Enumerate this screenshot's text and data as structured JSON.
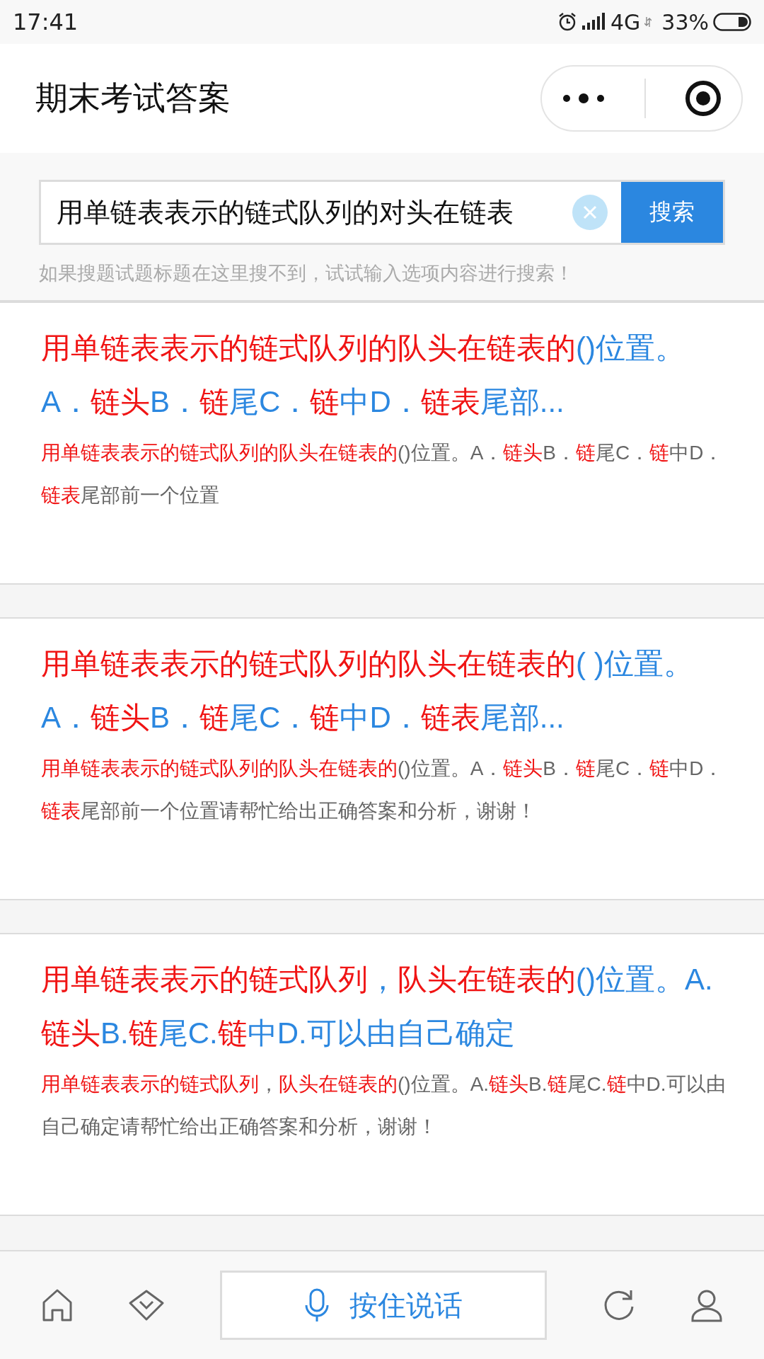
{
  "status_bar": {
    "time": "17:41",
    "network": "4G",
    "battery": "33%"
  },
  "header": {
    "title": "期末考试答案"
  },
  "search": {
    "value": "用单链表表示的链式队列的对头在链表",
    "button": "搜索",
    "hint": "如果搜题试题标题在这里搜不到，试试输入选项内容进行搜索！"
  },
  "results": [
    {
      "title": [
        {
          "text": "用单链表表示的链式队列的队头在链表的",
          "hl": true
        },
        {
          "text": "()位置。A．",
          "hl": false
        },
        {
          "text": "链头",
          "hl": true
        },
        {
          "text": "B．",
          "hl": false
        },
        {
          "text": "链",
          "hl": true
        },
        {
          "text": "尾C．",
          "hl": false
        },
        {
          "text": "链",
          "hl": true
        },
        {
          "text": "中D．",
          "hl": false
        },
        {
          "text": "链表",
          "hl": true
        },
        {
          "text": "尾部...",
          "hl": false
        }
      ],
      "snippet": [
        {
          "text": "用单链表表示的链式队列的队头在链表的",
          "hl": true
        },
        {
          "text": "()位置。A．",
          "hl": false
        },
        {
          "text": "链头",
          "hl": true
        },
        {
          "text": "B．",
          "hl": false
        },
        {
          "text": "链",
          "hl": true
        },
        {
          "text": "尾C．",
          "hl": false
        },
        {
          "text": "链",
          "hl": true
        },
        {
          "text": "中D．",
          "hl": false
        },
        {
          "text": "链表",
          "hl": true
        },
        {
          "text": "尾部前一个位置",
          "hl": false
        }
      ]
    },
    {
      "title": [
        {
          "text": "用单链表表示的链式队列的队头在链表的",
          "hl": true
        },
        {
          "text": "( )位置。A．",
          "hl": false
        },
        {
          "text": "链头",
          "hl": true
        },
        {
          "text": "B．",
          "hl": false
        },
        {
          "text": "链",
          "hl": true
        },
        {
          "text": "尾C．",
          "hl": false
        },
        {
          "text": "链",
          "hl": true
        },
        {
          "text": "中D．",
          "hl": false
        },
        {
          "text": "链表",
          "hl": true
        },
        {
          "text": "尾部...",
          "hl": false
        }
      ],
      "snippet": [
        {
          "text": "用单链表表示的链式队列的队头在链表的",
          "hl": true
        },
        {
          "text": "()位置。A．",
          "hl": false
        },
        {
          "text": "链头",
          "hl": true
        },
        {
          "text": "B．",
          "hl": false
        },
        {
          "text": "链",
          "hl": true
        },
        {
          "text": "尾C．",
          "hl": false
        },
        {
          "text": "链",
          "hl": true
        },
        {
          "text": "中D．",
          "hl": false
        },
        {
          "text": "链表",
          "hl": true
        },
        {
          "text": "尾部前一个位置请帮忙给出正确答案和分析，谢谢！",
          "hl": false
        }
      ]
    },
    {
      "title": [
        {
          "text": "用单链表表示的链式队列",
          "hl": true
        },
        {
          "text": "，",
          "hl": false
        },
        {
          "text": "队头在链表的",
          "hl": true
        },
        {
          "text": "()位置。A.",
          "hl": false
        },
        {
          "text": "链头",
          "hl": true
        },
        {
          "text": "B.",
          "hl": false
        },
        {
          "text": "链",
          "hl": true
        },
        {
          "text": "尾C.",
          "hl": false
        },
        {
          "text": "链",
          "hl": true
        },
        {
          "text": "中D.可以由自己确定",
          "hl": false
        }
      ],
      "snippet": [
        {
          "text": "用单链表表示的链式队列",
          "hl": true
        },
        {
          "text": "，",
          "hl": false
        },
        {
          "text": "队头在链表的",
          "hl": true
        },
        {
          "text": "()位置。A.",
          "hl": false
        },
        {
          "text": "链头",
          "hl": true
        },
        {
          "text": "B.",
          "hl": false
        },
        {
          "text": "链",
          "hl": true
        },
        {
          "text": "尾C.",
          "hl": false
        },
        {
          "text": "链",
          "hl": true
        },
        {
          "text": "中D.可以由自己确定请帮忙给出正确答案和分析，谢谢！",
          "hl": false
        }
      ]
    }
  ],
  "bottom_bar": {
    "voice_button": "按住说话"
  }
}
